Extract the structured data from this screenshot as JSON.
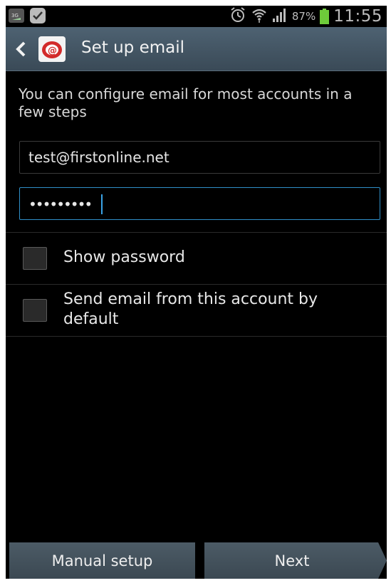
{
  "status_bar": {
    "battery_percent": "87%",
    "time": "11:55",
    "icons": [
      "3g-icon",
      "check-icon",
      "alarm-icon",
      "wifi-icon",
      "signal-icon",
      "battery-icon"
    ]
  },
  "action_bar": {
    "title": "Set up email",
    "back_icon": "chevron-left-icon",
    "app_icon": "email-app-icon"
  },
  "intro_text": "You can configure email for most accounts in a few steps",
  "email_field": {
    "value": "test@firstonline.net"
  },
  "password_field": {
    "masked_value": "•••••••••",
    "focused": true
  },
  "options": {
    "show_password": {
      "label": "Show password",
      "checked": false
    },
    "default_account": {
      "label": "Send email from this account by default",
      "checked": false
    }
  },
  "buttons": {
    "manual_setup": "Manual setup",
    "next": "Next"
  },
  "colors": {
    "action_bar": "#46596a",
    "focus_border": "#2f8fc8",
    "battery": "#6ecb3a",
    "button": "#46545e"
  }
}
